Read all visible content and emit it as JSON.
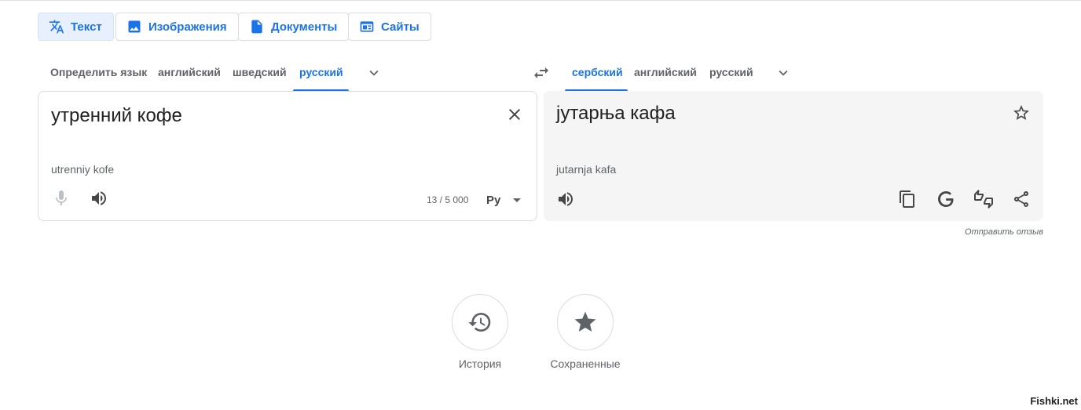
{
  "modes": [
    {
      "label": "Текст",
      "icon": "translate-icon",
      "active": true
    },
    {
      "label": "Изображения",
      "icon": "image-icon",
      "active": false
    },
    {
      "label": "Документы",
      "icon": "document-icon",
      "active": false
    },
    {
      "label": "Сайты",
      "icon": "website-icon",
      "active": false
    }
  ],
  "source_langs": [
    "Определить язык",
    "английский",
    "шведский",
    "русский"
  ],
  "source_selected": "русский",
  "target_langs": [
    "сербский",
    "английский",
    "русский"
  ],
  "target_selected": "сербский",
  "source": {
    "text": "утренний кофе",
    "transliteration": "utrenniy kofe",
    "counter": "13 / 5 000",
    "keyboard_label": "Ру"
  },
  "target": {
    "text": "јутарња кафа",
    "transliteration": "jutarnja kafa"
  },
  "feedback_link": "Отправить отзыв",
  "history_label": "История",
  "saved_label": "Сохраненные",
  "watermark": "Fishki.net",
  "colors": {
    "accent": "#1a73e8",
    "target_bg": "#f5f5f5"
  }
}
